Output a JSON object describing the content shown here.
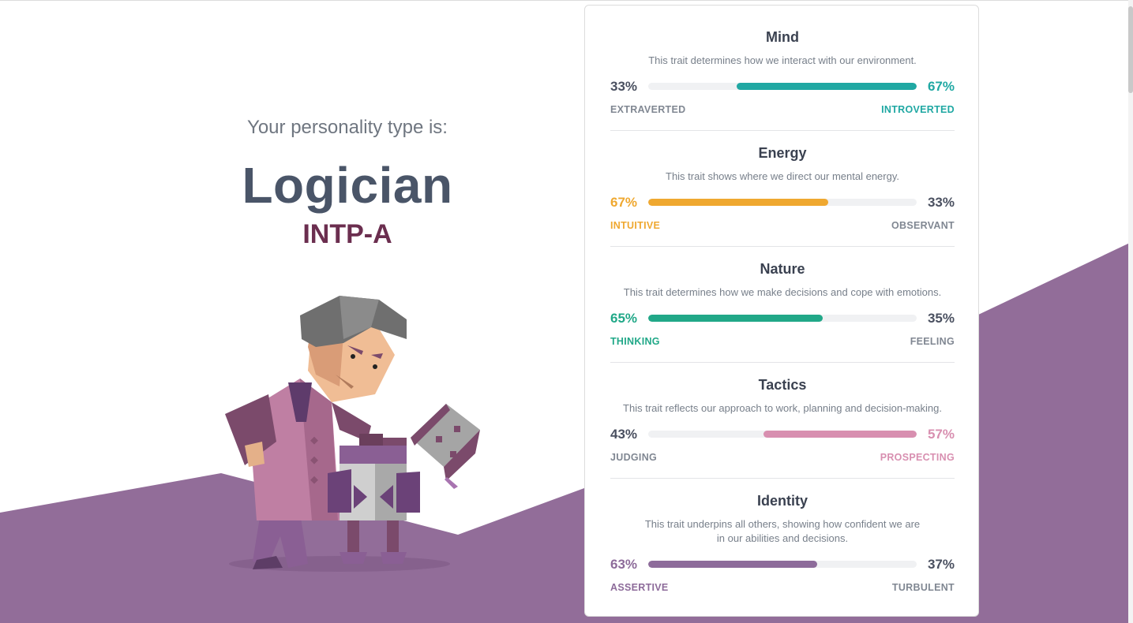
{
  "hero": {
    "pre_title": "Your personality type is:",
    "type_name": "Logician",
    "type_code": "INTP-A"
  },
  "colors": {
    "mind": "#20a8a3",
    "energy": "#efa830",
    "nature": "#21a888",
    "tactics": "#d88fb0",
    "identity": "#8d6b9a",
    "neutral_text": "#4a5060",
    "neutral_label": "#808792",
    "background_wave": "#926d99"
  },
  "traits": [
    {
      "title": "Mind",
      "description": "This trait determines how we interact with our environment.",
      "left_pct": "33%",
      "right_pct": "67%",
      "left_label": "EXTRAVERTED",
      "right_label": "INTROVERTED",
      "dominant": "right",
      "fill_fraction": 0.67,
      "color_key": "mind"
    },
    {
      "title": "Energy",
      "description": "This trait shows where we direct our mental energy.",
      "left_pct": "67%",
      "right_pct": "33%",
      "left_label": "INTUITIVE",
      "right_label": "OBSERVANT",
      "dominant": "left",
      "fill_fraction": 0.67,
      "color_key": "energy"
    },
    {
      "title": "Nature",
      "description": "This trait determines how we make decisions and cope with emotions.",
      "left_pct": "65%",
      "right_pct": "35%",
      "left_label": "THINKING",
      "right_label": "FEELING",
      "dominant": "left",
      "fill_fraction": 0.65,
      "color_key": "nature"
    },
    {
      "title": "Tactics",
      "description": "This trait reflects our approach to work, planning and decision-making.",
      "left_pct": "43%",
      "right_pct": "57%",
      "left_label": "JUDGING",
      "right_label": "PROSPECTING",
      "dominant": "right",
      "fill_fraction": 0.57,
      "color_key": "tactics"
    },
    {
      "title": "Identity",
      "description": "This trait underpins all others, showing how confident we are in our abilities and decisions.",
      "left_pct": "63%",
      "right_pct": "37%",
      "left_label": "ASSERTIVE",
      "right_label": "TURBULENT",
      "dominant": "left",
      "fill_fraction": 0.63,
      "color_key": "identity"
    }
  ]
}
